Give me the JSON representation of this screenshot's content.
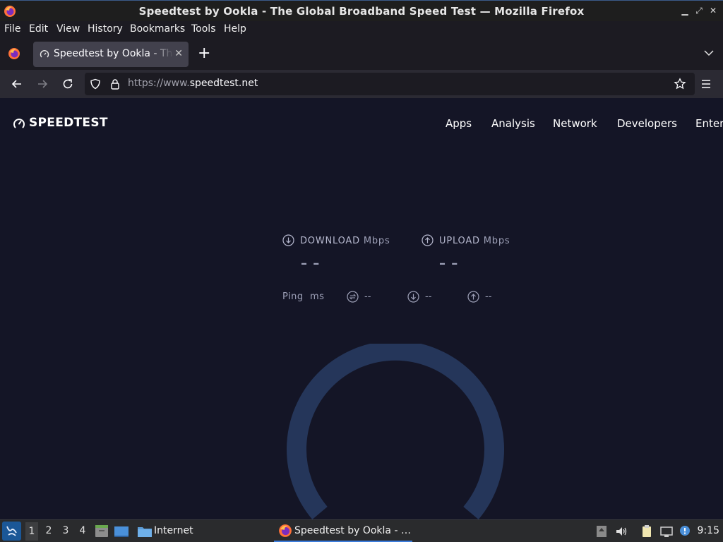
{
  "window": {
    "title": "Speedtest by Ookla - The Global Broadband Speed Test — Mozilla Firefox"
  },
  "menu": {
    "items": [
      {
        "label": "File"
      },
      {
        "label": "Edit"
      },
      {
        "label": "View"
      },
      {
        "label": "History"
      },
      {
        "label": "Bookmarks"
      },
      {
        "label": "Tools"
      },
      {
        "label": "Help"
      }
    ]
  },
  "tabs": [
    {
      "title": "Speedtest by Ookla - The Global Broadband Speed Test",
      "active": true
    }
  ],
  "urlbar": {
    "protocol": "https://www.",
    "domain": "speedtest.net"
  },
  "site": {
    "brand": "SPEEDTEST",
    "nav": [
      "Apps",
      "Analysis",
      "Network",
      "Developers",
      "Enterprise"
    ]
  },
  "metrics": {
    "download": {
      "label": "DOWNLOAD",
      "unit": "Mbps",
      "value": "– –"
    },
    "upload": {
      "label": "UPLOAD",
      "unit": "Mbps",
      "value": "– –"
    },
    "ping": {
      "label": "Ping",
      "unit": "ms",
      "idle": "--",
      "down": "--",
      "up": "--"
    }
  },
  "taskbar": {
    "workspaces": [
      "1",
      "2",
      "3",
      "4"
    ],
    "folder_label": "Internet",
    "task_title": "Speedtest by Ookla - …",
    "clock": "9:15"
  },
  "colors": {
    "page_bg": "#141526",
    "gauge_ring": "#25365a",
    "accent": "#3c7ddc"
  }
}
